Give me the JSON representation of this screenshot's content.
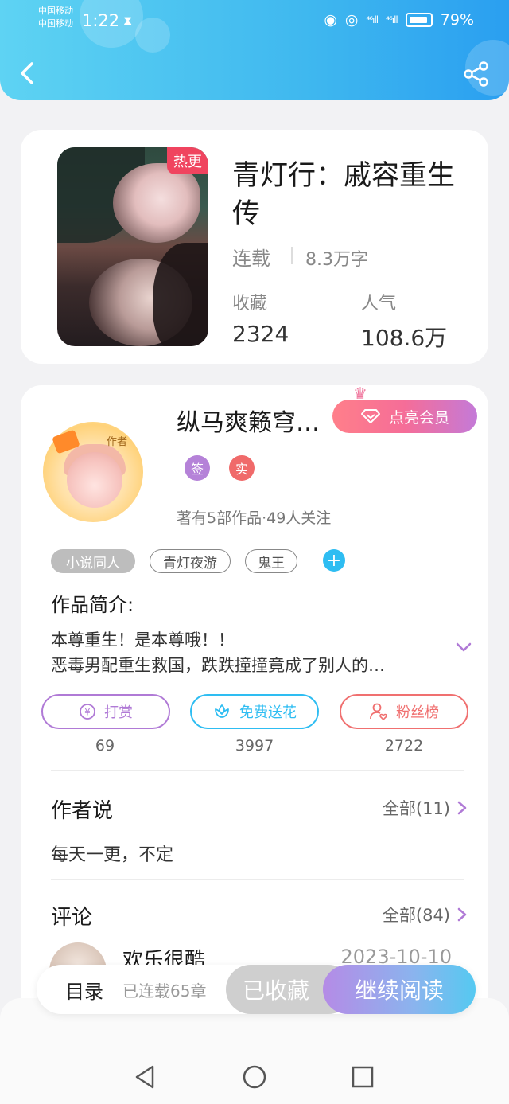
{
  "status_bar": {
    "carrier_1": "中国移动",
    "carrier_2": "中国移动",
    "time": "1:22",
    "signal_1": "⁴⁶ıll",
    "signal_2": "⁴⁶ıll",
    "battery": "79%"
  },
  "book": {
    "hot_badge": "热更",
    "title": "青灯行：戚容重生传",
    "status": "连载",
    "words": "8.3万字",
    "collect_label": "收藏",
    "collect_value": "2324",
    "popularity_label": "人气",
    "popularity_value": "108.6万"
  },
  "author": {
    "avatar_caption": "作者",
    "name": "纵马爽籁穹…",
    "vip_label": "点亮会员",
    "badge_sign": "签",
    "badge_real": "实",
    "meta": "著有5部作品·49人关注",
    "tags": [
      "小说同人",
      "青灯夜游",
      "鬼王"
    ]
  },
  "intro": {
    "title": "作品简介:",
    "line1": "本尊重生！是本尊哦！！",
    "line2": "恶毒男配重生救国，跌跌撞撞竟成了别人的…"
  },
  "actions": [
    {
      "label": "打赏",
      "count": "69",
      "color": "#b07ad6"
    },
    {
      "label": "免费送花",
      "count": "3997",
      "color": "#2ebdf2"
    },
    {
      "label": "粉丝榜",
      "count": "2722",
      "color": "#f07070"
    }
  ],
  "author_says": {
    "title": "作者说",
    "more": "全部(11)",
    "content": "每天一更，不定"
  },
  "comments": {
    "title": "评论",
    "more": "全部(84)",
    "first_user": "欢乐很酷",
    "first_date": "2023-10-10"
  },
  "bottom_bar": {
    "toc": "目录",
    "chapters": "已连载65章",
    "saved": "已收藏",
    "continue": "继续阅读"
  },
  "colors": {
    "header_start": "#5ed3f3",
    "header_end": "#2a9ff0",
    "accent_purple": "#b07ad6",
    "hot_red": "#f0445f"
  }
}
